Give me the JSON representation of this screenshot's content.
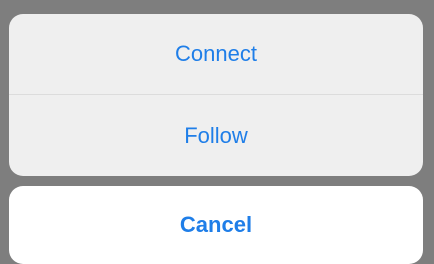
{
  "action_sheet": {
    "actions": [
      {
        "label": "Connect"
      },
      {
        "label": "Follow"
      }
    ],
    "cancel_label": "Cancel"
  },
  "colors": {
    "backdrop": "#7e7e7e",
    "group_background": "#efefef",
    "cancel_background": "#ffffff",
    "accent": "#1f7ee8",
    "separator": "#dcdcdc"
  }
}
